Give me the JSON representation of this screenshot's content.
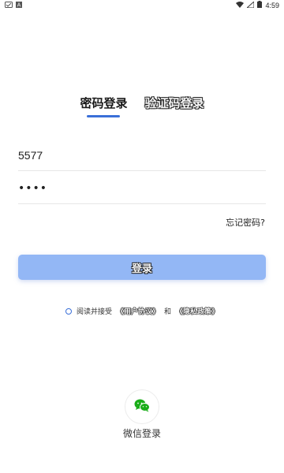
{
  "status_bar": {
    "time": "4:59",
    "icons": [
      "notification-icon",
      "text-icon",
      "wifi-icon",
      "signal-icon",
      "battery-icon"
    ]
  },
  "tabs": [
    {
      "label": "密码登录",
      "active": true
    },
    {
      "label": "验证码登录",
      "active": false
    }
  ],
  "form": {
    "username": "5577",
    "password_mask": "••••",
    "forgot_password": "忘记密码?"
  },
  "login_button": {
    "label": "登录",
    "color": "#93b7f5"
  },
  "agreement": {
    "prefix": "阅读并接受",
    "user_agreement": "《用户协议》",
    "and": "和",
    "privacy_policy": "《隐私政策》"
  },
  "wechat": {
    "label": "微信登录",
    "icon": "wechat-icon",
    "color": "#1aad19"
  },
  "accent_color": "#3a6fd8"
}
